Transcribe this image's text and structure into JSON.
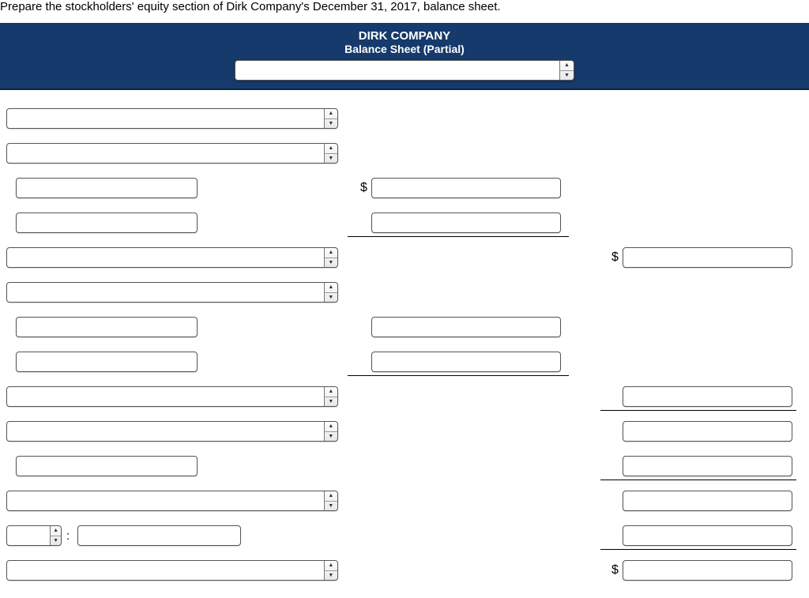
{
  "prompt": "Prepare the stockholders' equity section of Dirk Company's December 31, 2017, balance sheet.",
  "header": {
    "company": "DIRK COMPANY",
    "subtitle": "Balance Sheet (Partial)",
    "date_select_value": ""
  },
  "symbols": {
    "dollar": "$",
    "colon": ":"
  },
  "rows": {
    "r1": {
      "label_select": ""
    },
    "r2": {
      "label_select": ""
    },
    "r3": {
      "label_text": "",
      "mid_value": ""
    },
    "r4": {
      "label_text": "",
      "mid_value": ""
    },
    "r5": {
      "label_select": "",
      "right_value": ""
    },
    "r6": {
      "label_select": ""
    },
    "r7": {
      "label_text": "",
      "mid_value": ""
    },
    "r8": {
      "label_text": "",
      "mid_value": ""
    },
    "r9": {
      "label_select": "",
      "right_value": ""
    },
    "r10": {
      "label_select": "",
      "right_value": ""
    },
    "r11": {
      "label_text": "",
      "right_value": ""
    },
    "r12": {
      "label_select": "",
      "right_value": ""
    },
    "r13": {
      "label_select_small": "",
      "label_text": "",
      "right_value": ""
    },
    "r14": {
      "label_select": "",
      "right_value": ""
    }
  }
}
